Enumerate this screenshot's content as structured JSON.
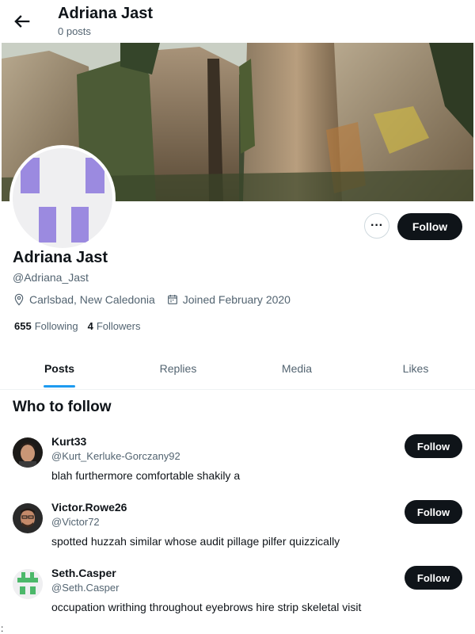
{
  "header": {
    "title": "Adriana Jast",
    "post_count": "0 posts"
  },
  "profile": {
    "name": "Adriana Jast",
    "handle": "@Adriana_Jast",
    "location": "Carlsbad, New Caledonia",
    "joined": "Joined February 2020",
    "following_count": "655",
    "following_label": "Following",
    "followers_count": "4",
    "followers_label": "Followers",
    "follow_label": "Follow",
    "more_label": "···"
  },
  "tabs": [
    {
      "label": "Posts",
      "active": true
    },
    {
      "label": "Replies",
      "active": false
    },
    {
      "label": "Media",
      "active": false
    },
    {
      "label": "Likes",
      "active": false
    }
  ],
  "who_to_follow": {
    "title": "Who to follow",
    "suggestions": [
      {
        "name": "Kurt33",
        "handle": "@Kurt_Kerluke-Gorczany92",
        "bio": "blah furthermore comfortable shakily a",
        "follow_label": "Follow"
      },
      {
        "name": "Victor.Rowe26",
        "handle": "@Victor72",
        "bio": "spotted huzzah similar whose audit pillage pilfer quizzically",
        "follow_label": "Follow"
      },
      {
        "name": "Seth.Casper",
        "handle": "@Seth.Casper",
        "bio": "occupation writhing throughout eyebrows hire strip skeletal visit",
        "follow_label": "Follow"
      }
    ]
  },
  "footer_mark": ":",
  "colors": {
    "accent": "#1d9bf0",
    "button": "#0f1419",
    "muted": "#536471",
    "avatar_tile": "#9b8ae0",
    "seth_tile": "#4cb86a"
  }
}
